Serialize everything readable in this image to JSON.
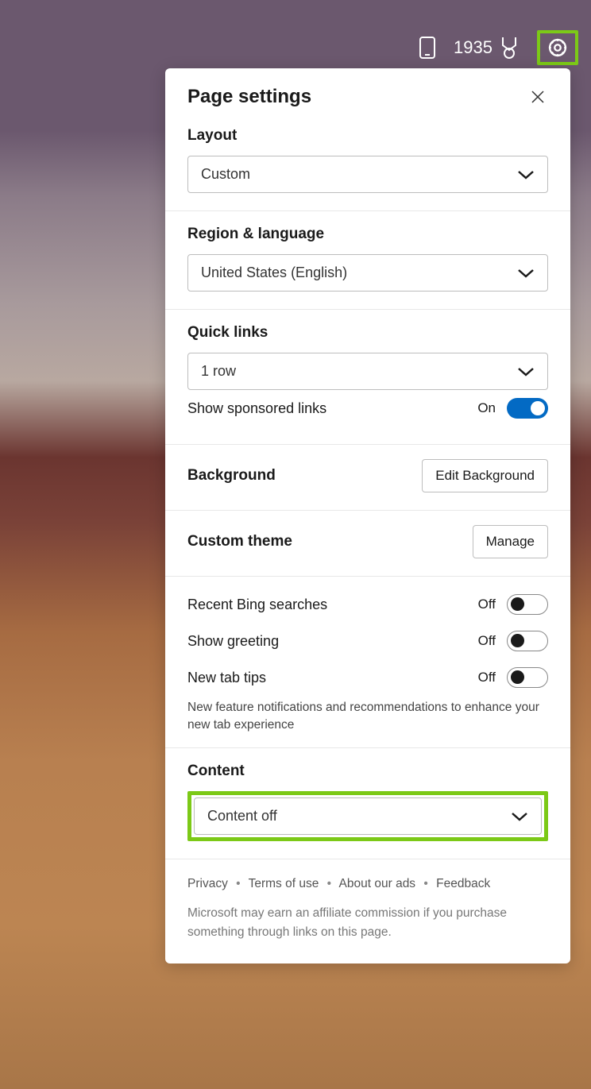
{
  "toolbar": {
    "points": "1935"
  },
  "panel": {
    "title": "Page settings"
  },
  "layout": {
    "heading": "Layout",
    "value": "Custom"
  },
  "region": {
    "heading": "Region & language",
    "value": "United States (English)"
  },
  "quicklinks": {
    "heading": "Quick links",
    "value": "1 row",
    "sponsored_label": "Show sponsored links",
    "sponsored_state": "On"
  },
  "background": {
    "heading": "Background",
    "button": "Edit Background"
  },
  "theme": {
    "heading": "Custom theme",
    "button": "Manage"
  },
  "toggles": {
    "recent_bing_label": "Recent Bing searches",
    "recent_bing_state": "Off",
    "greeting_label": "Show greeting",
    "greeting_state": "Off",
    "tips_label": "New tab tips",
    "tips_state": "Off",
    "tips_desc": "New feature notifications and recommendations to enhance your new tab experience"
  },
  "content": {
    "heading": "Content",
    "value": "Content off"
  },
  "footer": {
    "privacy": "Privacy",
    "terms": "Terms of use",
    "ads": "About our ads",
    "feedback": "Feedback",
    "disclaimer": "Microsoft may earn an affiliate commission if you purchase something through links on this page."
  }
}
